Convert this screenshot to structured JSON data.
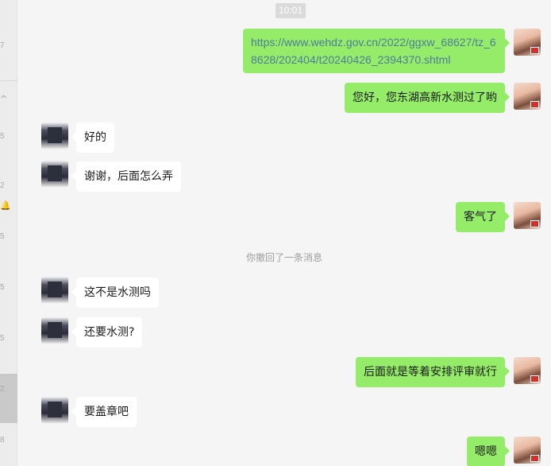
{
  "sidebar_fragments": [
    "7",
    "5",
    "2",
    "5",
    "5",
    "5",
    "2",
    "8"
  ],
  "sidebar_icons": {
    "collapse": "chevron-up-icon",
    "mute": "bell-muted-icon"
  },
  "timestamp": "10:01",
  "system_notice": "你撤回了一条消息",
  "messages": [
    {
      "from": "me",
      "type": "link",
      "text": "https://www.wehdz.gov.cn/2022/ggxw_68627/tz_68628/202404/t20240426_2394370.shtml"
    },
    {
      "from": "me",
      "text": "您好，您东湖高新水测过了哟"
    },
    {
      "from": "other",
      "text": "好的"
    },
    {
      "from": "other",
      "text": "谢谢，后面怎么弄"
    },
    {
      "from": "me",
      "text": "客气了"
    },
    {
      "from": "other",
      "text": "这不是水测吗"
    },
    {
      "from": "other",
      "text": "还要水测?"
    },
    {
      "from": "me",
      "text": "后面就是等着安排评审就行"
    },
    {
      "from": "other",
      "text": "要盖章吧"
    },
    {
      "from": "me",
      "text": "嗯嗯"
    }
  ],
  "colors": {
    "me_bubble": "#95ec69",
    "other_bubble": "#ffffff",
    "background": "#f5f5f5",
    "link": "#4d7d9a"
  }
}
